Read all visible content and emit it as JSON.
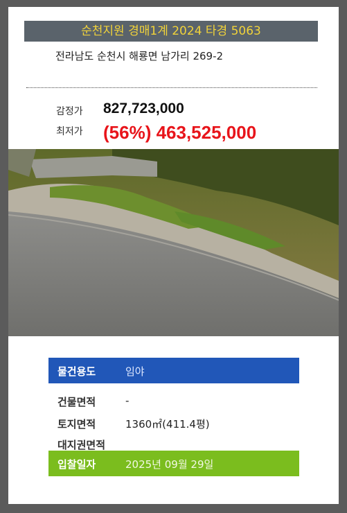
{
  "header": {
    "title": "순천지원 경매1계 2024 타경 5063",
    "title_color": "#f1d33a",
    "title_bg": "#5a636b"
  },
  "address": "전라남도 순천시 해룡면 남가리 269-2",
  "price": {
    "appraisal_label": "감정가",
    "appraisal_value": "827,723,000",
    "minimum_label": "최저가",
    "minimum_value": "(56%) 463,525,000",
    "minimum_color": "#e8141a"
  },
  "photo": {
    "subject": "sloped roadside land with stone wall and green vegetation"
  },
  "details": {
    "usage_label": "물건용도",
    "usage_value": "임야",
    "building_area_label": "건물면적",
    "building_area_value": "-",
    "land_area_label": "토지면적",
    "land_area_value": "1360㎡(411.4평)",
    "land_rights_label": "대지권면적",
    "land_rights_value": "",
    "bid_date_label": "입찰일자",
    "bid_date_value": "2025년 09월 29일"
  },
  "colors": {
    "usage_row": "#2157b8",
    "bid_row": "#7bbd1e",
    "frame": "#5b5b5b"
  }
}
